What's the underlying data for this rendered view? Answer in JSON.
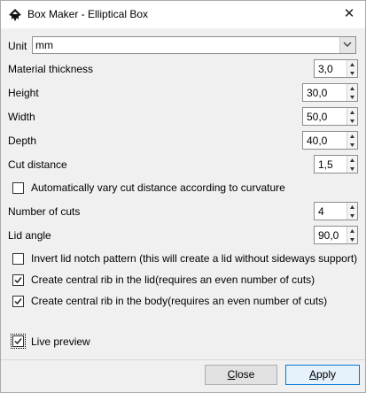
{
  "window": {
    "title": "Box Maker - Elliptical Box"
  },
  "unit": {
    "label": "Unit",
    "value": "mm"
  },
  "fields": {
    "material_thickness": {
      "label": "Material thickness",
      "value": "3,0"
    },
    "height": {
      "label": "Height",
      "value": "30,0"
    },
    "width": {
      "label": "Width",
      "value": "50,0"
    },
    "depth": {
      "label": "Depth",
      "value": "40,0"
    },
    "cut_distance": {
      "label": "Cut distance",
      "value": "1,5"
    },
    "number_of_cuts": {
      "label": "Number of cuts",
      "value": "4"
    },
    "lid_angle": {
      "label": "Lid angle",
      "value": "90,0"
    }
  },
  "checkboxes": {
    "vary_cut": {
      "label": "Automatically vary cut distance according to curvature",
      "checked": false
    },
    "invert_lid": {
      "label": "Invert lid notch pattern (this will create a lid without sideways support)",
      "checked": false
    },
    "rib_lid": {
      "label": "Create central rib in the lid(requires an even number of cuts)",
      "checked": true
    },
    "rib_body": {
      "label": "Create central rib in the body(requires an even number of cuts)",
      "checked": true
    },
    "live_preview": {
      "label": "Live preview",
      "checked": true
    }
  },
  "buttons": {
    "close_accesskey": "C",
    "close_rest": "lose",
    "apply_accesskey": "A",
    "apply_rest": "pply"
  },
  "icons": [
    "inkscape-app-icon",
    "close-icon",
    "chevron-down-icon",
    "spin-up-icon",
    "spin-down-icon",
    "checkmark-icon"
  ]
}
